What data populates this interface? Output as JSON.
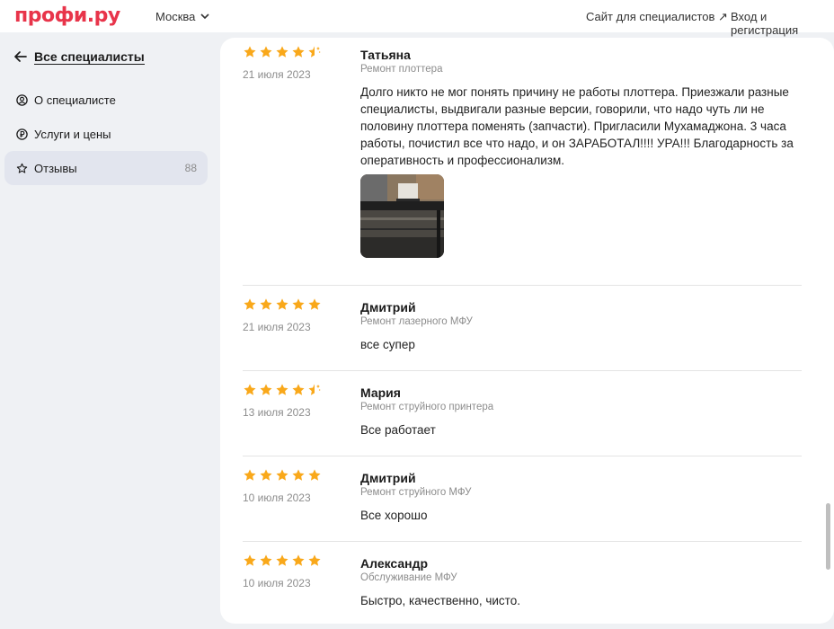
{
  "header": {
    "logo": "профи.ру",
    "city": "Москва",
    "site_link": "Сайт для специалистов ↗",
    "login_link": "Вход и регистрация"
  },
  "sidebar": {
    "back_label": "Все специалисты",
    "items": [
      {
        "label": "О специалисте",
        "icon": "person-circle-icon"
      },
      {
        "label": "Услуги и цены",
        "icon": "ruble-circle-icon"
      },
      {
        "label": "Отзывы",
        "icon": "star-outline-icon",
        "count": "88"
      }
    ]
  },
  "colors": {
    "brand": "#e8344a",
    "star": "#f9a81a",
    "active_nav": "#e2e5ee"
  },
  "reviews": [
    {
      "name": "Татьяна",
      "service": "Ремонт плоттера",
      "date": "21 июля 2023",
      "rating": 4.5,
      "text": "Долго никто не мог понять причину не работы плоттера. Приезжали разные специалисты, выдвигали разные версии, говорили, что надо чуть ли не половину плоттера поменять (запчасти). Пригласили Мухамаджона. 3 часа работы, почистил все что надо, и он ЗАРАБОТАЛ!!!! УРА!!! Благодарность за оперативность и профессионализм.",
      "has_photo": true
    },
    {
      "name": "Дмитрий",
      "service": "Ремонт лазерного МФУ",
      "date": "21 июля 2023",
      "rating": 5,
      "text": "все супер"
    },
    {
      "name": "Мария",
      "service": "Ремонт струйного принтера",
      "date": "13 июля 2023",
      "rating": 4.5,
      "text": "Все работает"
    },
    {
      "name": "Дмитрий",
      "service": "Ремонт струйного МФУ",
      "date": "10 июля 2023",
      "rating": 5,
      "text": "Все хорошо"
    },
    {
      "name": "Александр",
      "service": "Обслуживание МФУ",
      "date": "10 июля 2023",
      "rating": 5,
      "text": "Быстро, качественно, чисто."
    }
  ]
}
